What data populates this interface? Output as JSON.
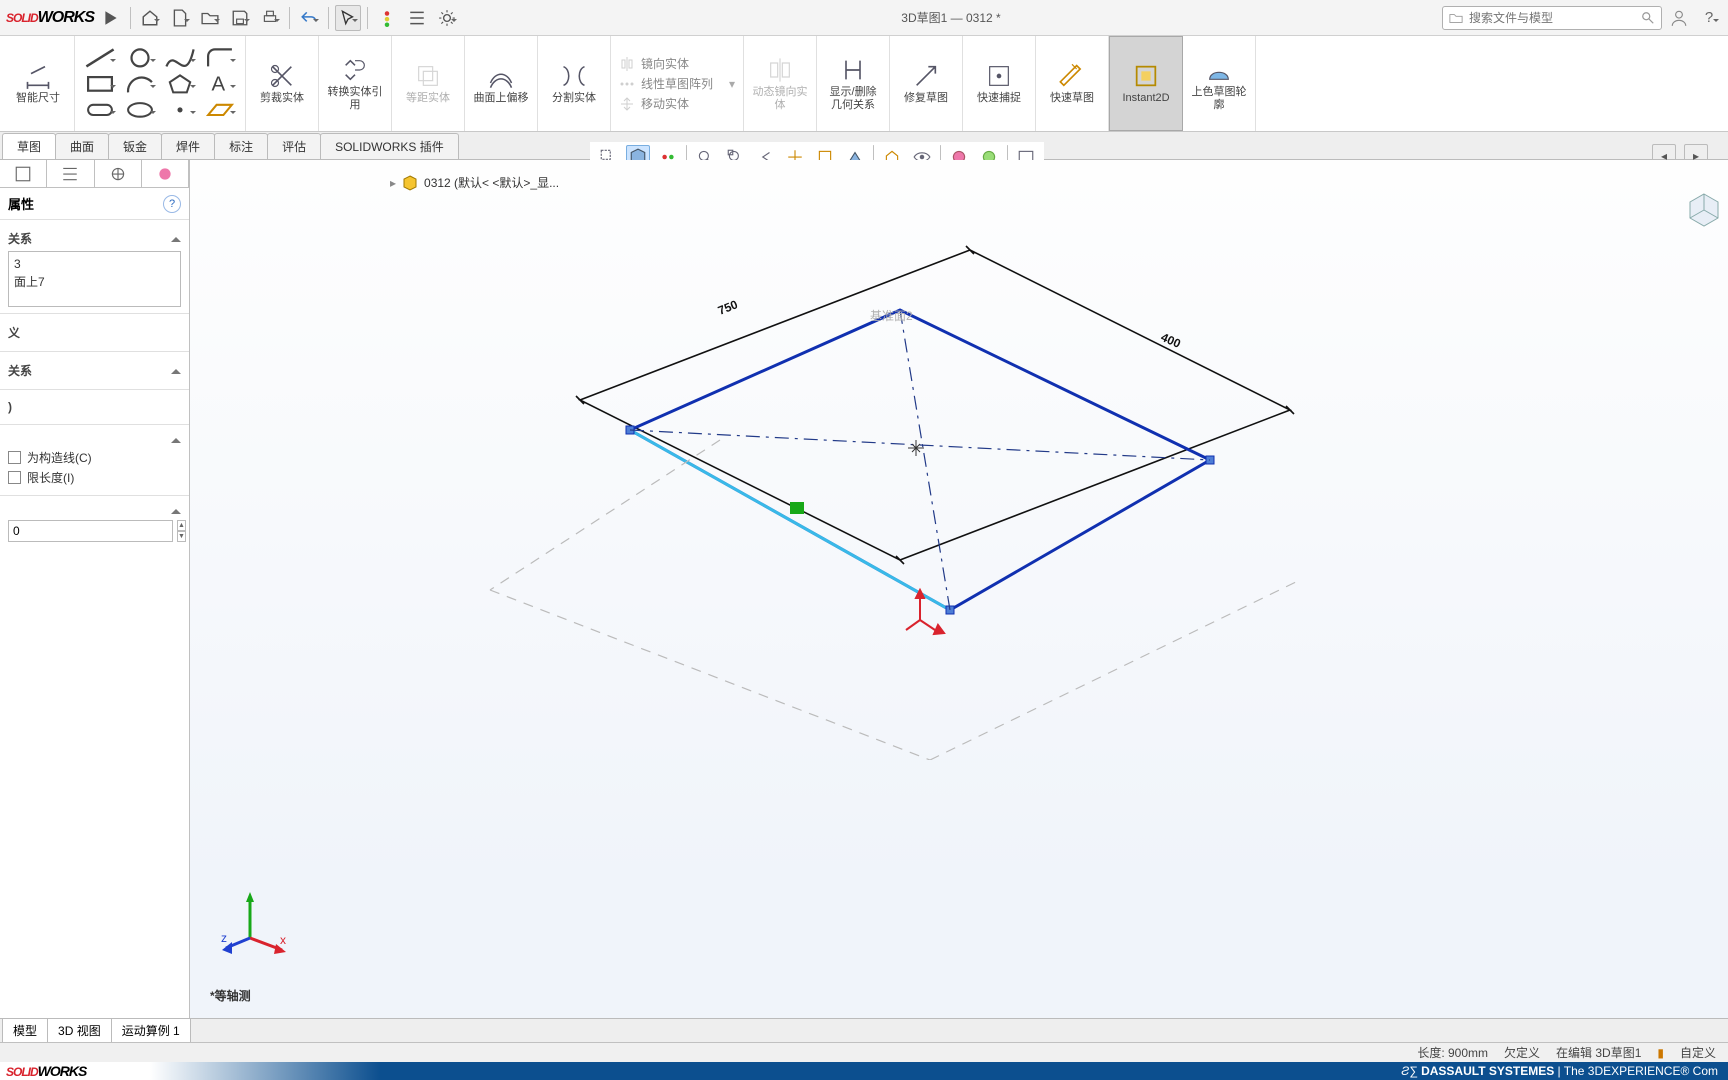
{
  "title": "3D草图1 — 0312 *",
  "search_placeholder": "搜索文件与模型",
  "ribbon": {
    "smart_dim": "智能尺寸",
    "trim": "剪裁实体",
    "convert": "转换实体引用",
    "offset_dist": "等距实体",
    "surf_offset": "曲面上偏移",
    "split": "分割实体",
    "mirror": "镜向实体",
    "linear_pattern": "线性草图阵列",
    "move": "移动实体",
    "dyn_mirror": "动态镜向实体",
    "show_rel": "显示/删除几何关系",
    "repair": "修复草图",
    "snap": "快速捕捉",
    "quick": "快速草图",
    "instant2d": "Instant2D",
    "shaded": "上色草图轮廓"
  },
  "tabs": [
    "草图",
    "曲面",
    "钣金",
    "焊件",
    "标注",
    "评估",
    "SOLIDWORKS 插件"
  ],
  "breadcrumb": "0312  (默认< <默认>_显...",
  "panel": {
    "title": "属性",
    "sec1": "关系",
    "item1": "3",
    "item2": "面上7",
    "sec2": "义",
    "sec3": "关系",
    "sec4": ")",
    "check1": "为构造线(C)",
    "check2": "限长度(I)",
    "numval": "0"
  },
  "canvas": {
    "plane_label": "基准面2",
    "dim1": "750",
    "dim2": "400",
    "viewlabel": "*等轴测"
  },
  "bottom_tabs": [
    "模型",
    "3D 视图",
    "运动算例 1"
  ],
  "status": {
    "length": "长度: 900mm",
    "under": "欠定义",
    "edit": "在编辑 3D草图1",
    "custom": "自定义"
  },
  "brand": {
    "ds": "DASSAULT SYSTEMES",
    "exp": " | The 3DEXPERIENCE® Com"
  }
}
